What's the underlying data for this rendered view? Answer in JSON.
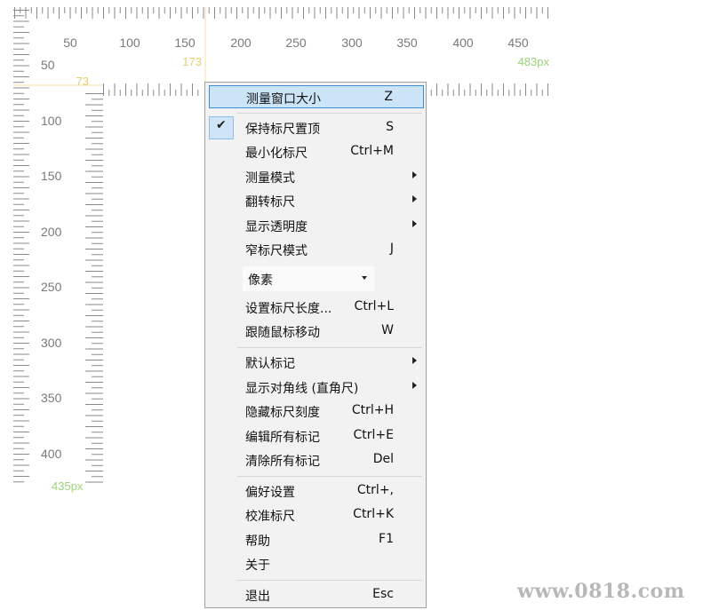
{
  "ruler": {
    "top_labels": [
      "50",
      "100",
      "150",
      "200",
      "250",
      "300",
      "350",
      "400",
      "450"
    ],
    "left_labels": [
      "50",
      "100",
      "150",
      "200",
      "250",
      "300",
      "350",
      "400"
    ],
    "x_marker": "173",
    "y_marker": "73",
    "width_readout": "483px",
    "height_readout": "435px",
    "colors": {
      "tick": "#8a8a8a",
      "label": "#7a7a7a",
      "readout": "#9bd37a",
      "marker": "#e9cc73",
      "guide": "#f3e2a6"
    }
  },
  "menu": {
    "items": [
      {
        "label": "测量窗口大小",
        "shortcut": "Z"
      },
      {
        "label": "保持标尺置顶",
        "shortcut": "S"
      },
      {
        "label": "最小化标尺",
        "shortcut": "Ctrl+M"
      },
      {
        "label": "测量模式",
        "shortcut": ""
      },
      {
        "label": "翻转标尺",
        "shortcut": ""
      },
      {
        "label": "显示透明度",
        "shortcut": ""
      },
      {
        "label": "窄标尺模式",
        "shortcut": "J"
      },
      {
        "label": "设置标尺长度...",
        "shortcut": "Ctrl+L"
      },
      {
        "label": "跟随鼠标移动",
        "shortcut": "W"
      },
      {
        "label": "默认标记",
        "shortcut": ""
      },
      {
        "label": "显示对角线 (直角尺)",
        "shortcut": ""
      },
      {
        "label": "隐藏标尺刻度",
        "shortcut": "Ctrl+H"
      },
      {
        "label": "编辑所有标记",
        "shortcut": "Ctrl+E"
      },
      {
        "label": "清除所有标记",
        "shortcut": "Del"
      },
      {
        "label": "偏好设置",
        "shortcut": "Ctrl+,"
      },
      {
        "label": "校准标尺",
        "shortcut": "Ctrl+K"
      },
      {
        "label": "帮助",
        "shortcut": "F1"
      },
      {
        "label": "关于",
        "shortcut": ""
      },
      {
        "label": "退出",
        "shortcut": "Esc"
      }
    ],
    "check_mark": "✔",
    "unit_select": "像素",
    "highlight_color": "#cce4f7"
  },
  "watermark": "www.0818.com"
}
